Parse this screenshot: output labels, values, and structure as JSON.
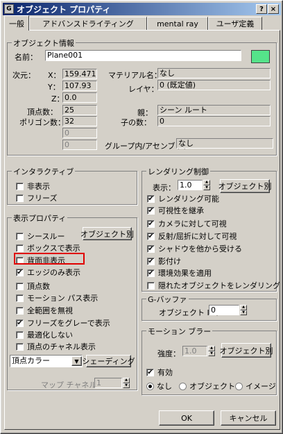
{
  "window": {
    "title": "オブジェクト プロパティ",
    "help_label": "?",
    "close_label": "×",
    "app_icon": "G"
  },
  "tabs": [
    "一般",
    "アドバンスドライティング",
    "mental ray",
    "ユーザ定義"
  ],
  "object_info": {
    "group_title": "オブジェクト情報",
    "name_label": "名前：",
    "name_value": "Plane001",
    "color": "#55e38a",
    "dimensions_label": "次元：",
    "x_label": "X：",
    "x_value": "159.471",
    "y_label": "Y：",
    "y_value": "107.93",
    "z_label": "Z：",
    "z_value": "0.0",
    "material_label": "マテリアル名：",
    "material_value": "なし",
    "layer_label": "レイヤ：",
    "layer_value": "0 (既定値)",
    "vertices_label": "頂点数：",
    "vertices_value": "25",
    "polygons_label": "ポリゴン数：",
    "polygons_value": "32",
    "parent_label": "親：",
    "parent_value": "シーン ルート",
    "children_label": "子の数：",
    "children_value": "0",
    "blank1_value": "0",
    "blank2_value": "0",
    "group_label": "グループ内/アセンブリ：",
    "group_value": "なし"
  },
  "interactive": {
    "group_title": "インタラクティブ",
    "hide_label": "非表示",
    "freeze_label": "フリーズ"
  },
  "display": {
    "group_title": "表示プロパティ",
    "by_object_button": "オブジェクト別",
    "see_through": "シースルー",
    "display_as_box": "ボックスで表示",
    "backface_cull": "背面非表示",
    "edges_only": "エッジのみ表示",
    "vertex_ticks": "頂点数",
    "motion_path": "モーション パス表示",
    "ignore_extents": "全範囲を無視",
    "show_frozen_gray": "フリーズをグレーで表示",
    "never_degrade": "最適化しない",
    "vertex_channel": "頂点のチャネル表示",
    "vertex_color_select": "頂点カラー",
    "shading_button": "シェーディング",
    "map_channel_label": "マップ チャネル：",
    "map_channel_value": "1"
  },
  "rendering": {
    "group_title": "レンダリング制御",
    "visibility_label": "表示：",
    "visibility_value": "1.0",
    "by_object_button": "オブジェクト別",
    "renderable": "レンダリング可能",
    "inherit_visibility": "可視性を継承",
    "visible_to_camera": "カメラに対して可視",
    "visible_reflect": "反射/屈折に対して可視",
    "receive_shadows": "シャドウを他から受ける",
    "cast_shadows": "影付け",
    "apply_atmospherics": "環境効果を適用",
    "render_occluded": "隠れたオブジェクトをレンダリング"
  },
  "gbuffer": {
    "group_title": "G-バッファ",
    "object_id_label": "オブジェクト ID：",
    "object_id_value": "0"
  },
  "motion_blur": {
    "group_title": "モーション ブラー",
    "strength_label": "強度：",
    "strength_value": "1.0",
    "by_object_button": "オブジェクト別",
    "enabled_label": "有効",
    "none_label": "なし",
    "object_label": "オブジェクト",
    "image_label": "イメージ"
  },
  "footer": {
    "ok_label": "OK",
    "cancel_label": "キャンセル"
  },
  "highlight_color": "#e00000"
}
